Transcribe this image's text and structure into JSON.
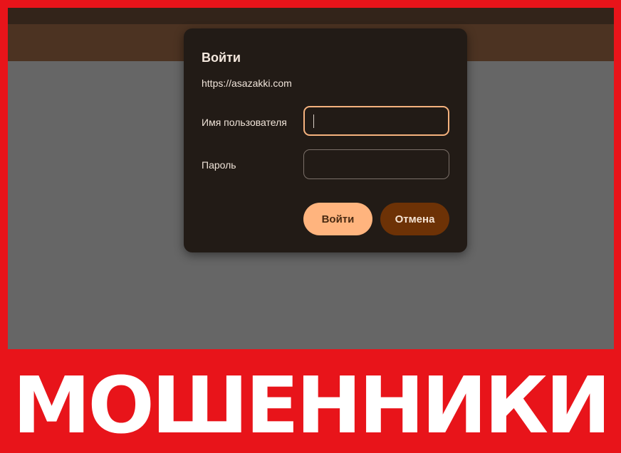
{
  "dialog": {
    "title": "Войти",
    "url": "https://asazakki.com",
    "username_label": "Имя пользователя",
    "username_value": "",
    "password_label": "Пароль",
    "password_value": "",
    "login_button": "Войти",
    "cancel_button": "Отмена"
  },
  "banner": {
    "text": "МОШЕННИКИ"
  },
  "colors": {
    "frame": "#e8141a",
    "dialog_bg": "#221b16",
    "login_button": "#ffb47e",
    "cancel_button": "#6d3206",
    "focus_border": "#f5b27e"
  }
}
